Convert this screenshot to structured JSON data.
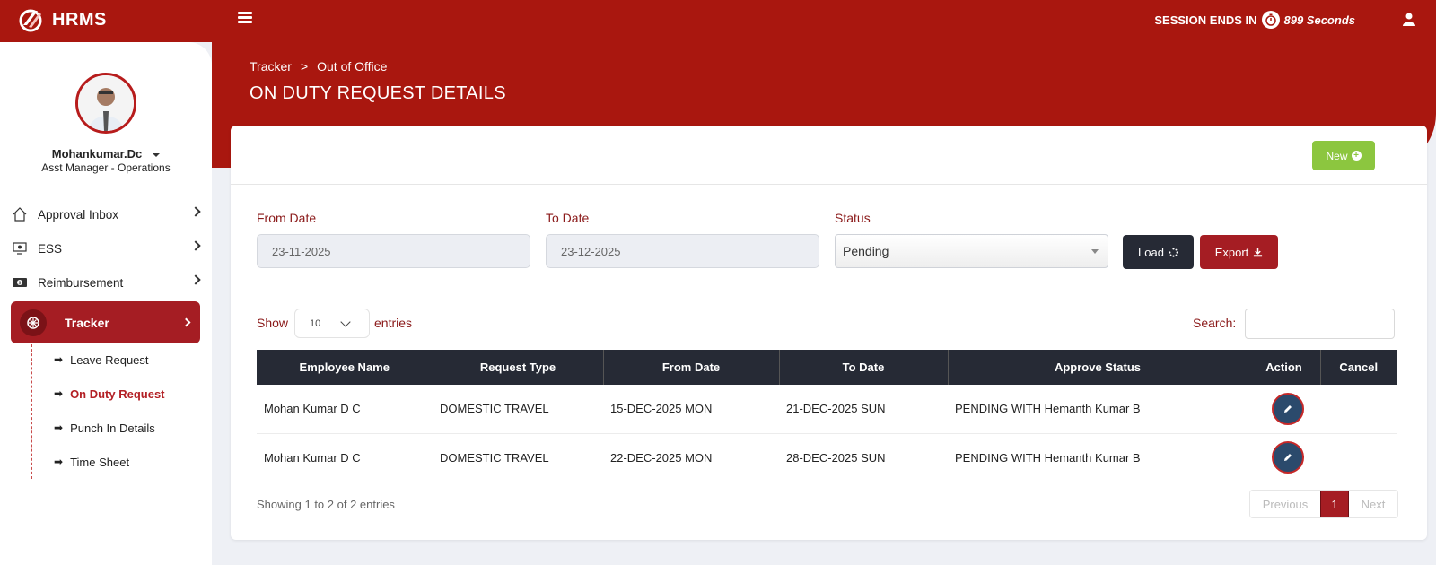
{
  "brand": {
    "name": "HRMS"
  },
  "session": {
    "label": "SESSION ENDS IN",
    "seconds": "899 Seconds"
  },
  "breadcrumb": {
    "parent": "Tracker",
    "separator": ">",
    "current": "Out of Office"
  },
  "page_title": "ON DUTY REQUEST DETAILS",
  "user": {
    "name": "Mohankumar.Dc",
    "role": "Asst Manager - Operations"
  },
  "sidebar": {
    "items": [
      {
        "label": "Approval Inbox",
        "icon": "home-icon"
      },
      {
        "label": "ESS",
        "icon": "monitor-icon"
      },
      {
        "label": "Reimbursement",
        "icon": "cash-icon"
      }
    ],
    "active": {
      "label": "Tracker",
      "icon": "tracker-icon"
    },
    "sub_items": [
      {
        "label": "Leave Request"
      },
      {
        "label": "On Duty Request",
        "active": true
      },
      {
        "label": "Punch In Details"
      },
      {
        "label": "Time Sheet"
      }
    ]
  },
  "toolbar": {
    "new_label": "New"
  },
  "filters": {
    "from_date_label": "From Date",
    "from_date_value": "23-11-2025",
    "to_date_label": "To Date",
    "to_date_value": "23-12-2025",
    "status_label": "Status",
    "status_value": "Pending",
    "load_label": "Load",
    "export_label": "Export"
  },
  "table_controls": {
    "show_label": "Show",
    "entries_label": "entries",
    "page_length": "10",
    "search_label": "Search:"
  },
  "table": {
    "headers": [
      "Employee Name",
      "Request Type",
      "From Date",
      "To Date",
      "Approve Status",
      "Action",
      "Cancel"
    ],
    "rows": [
      {
        "employee": "Mohan Kumar D C",
        "type": "DOMESTIC TRAVEL",
        "from": "15-DEC-2025 MON",
        "to": "21-DEC-2025 SUN",
        "status": "PENDING WITH Hemanth Kumar B"
      },
      {
        "employee": "Mohan Kumar D C",
        "type": "DOMESTIC TRAVEL",
        "from": "22-DEC-2025 MON",
        "to": "28-DEC-2025 SUN",
        "status": "PENDING WITH Hemanth Kumar B"
      }
    ]
  },
  "footer": {
    "showing": "Showing 1 to 2 of 2 entries",
    "previous": "Previous",
    "current_page": "1",
    "next": "Next"
  },
  "colors": {
    "primary": "#a9170f",
    "dark": "#262a35",
    "accent_green": "#8cc63f"
  }
}
